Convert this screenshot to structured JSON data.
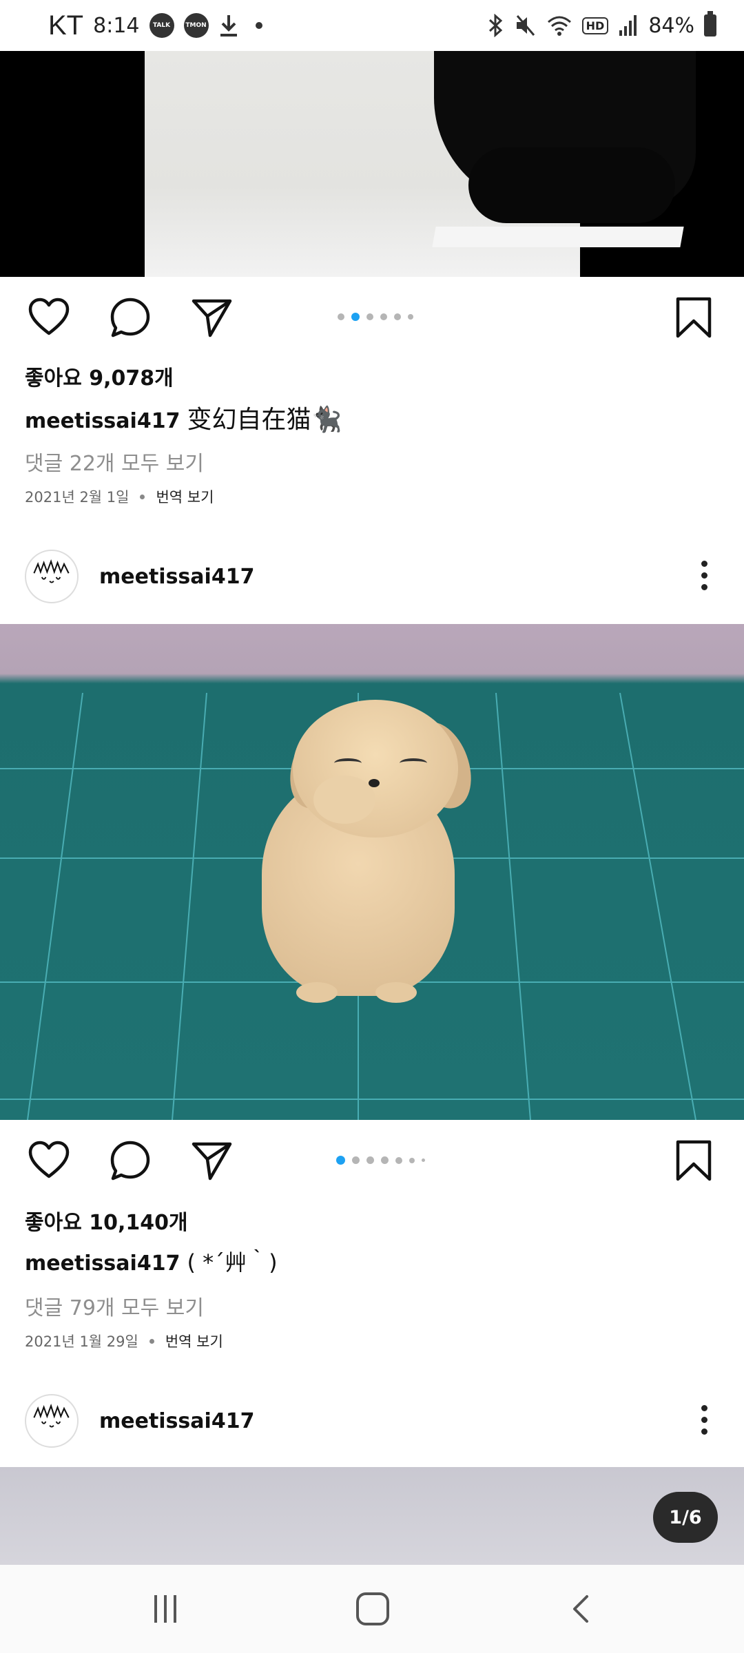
{
  "status_bar": {
    "carrier": "KT",
    "time": "8:14",
    "badge_talk": "TALK",
    "badge_tmon": "TMON",
    "hd": "HD",
    "battery": "84%"
  },
  "icons": {
    "status": [
      "download-icon",
      "bluetooth-icon",
      "mute-icon",
      "wifi-icon",
      "signal-icon",
      "battery-icon"
    ],
    "actions": [
      "heart-icon",
      "comment-icon",
      "send-icon",
      "bookmark-icon"
    ],
    "nav": [
      "recents-icon",
      "home-icon",
      "back-icon"
    ]
  },
  "colors": {
    "accent": "#1da1f2",
    "dot_inactive": "#b5b5b5",
    "comment_grey": "#8e8e8e"
  },
  "posts": [
    {
      "likes": "좋아요 9,078개",
      "username": "meetissai417",
      "caption": "变幻自在猫🐈‍⬛",
      "view_comments": "댓글 22개 모두 보기",
      "date": "2021년 2월 1일",
      "translate": "번역 보기"
    },
    {
      "username": "meetissai417",
      "likes": "좋아요 10,140개",
      "caption": "( *´艸｀)",
      "view_comments": "댓글 79개 모두 보기",
      "date": "2021년 1월 29일",
      "translate": "번역 보기"
    },
    {
      "username": "meetissai417",
      "page_indicator": "1/6"
    }
  ]
}
